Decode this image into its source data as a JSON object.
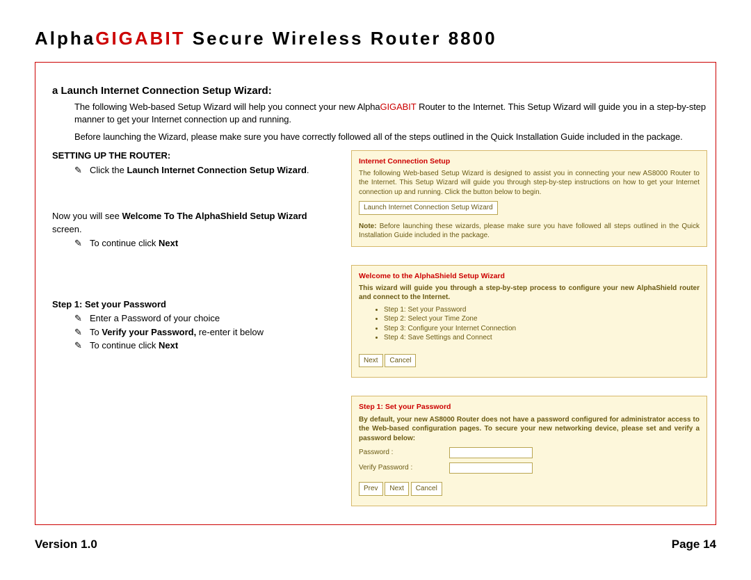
{
  "title": {
    "part1": "Alpha",
    "brand": "GIGABIT",
    "part2": " Secure Wireless Router 8800"
  },
  "sectionA": {
    "heading": "a Launch Internet Connection Setup Wizard:",
    "p1a": "The following Web-based Setup Wizard will help you connect your new Alpha",
    "p1brand": "GIGABIT",
    "p1b": " Router to the Internet. This Setup Wizard will guide you in a step-by-step manner to get your Internet connection up and running.",
    "p2": "Before launching the Wizard, please make sure you have correctly followed all of the steps outlined in the Quick Installation Guide included in the package."
  },
  "settingUp": {
    "heading": "SETTING UP THE ROUTER:",
    "bullet_prefix": "Click the ",
    "bullet_bold": "Launch Internet Connection Setup Wizard",
    "bullet_suffix": "."
  },
  "welcome": {
    "lead_prefix": "Now you will see ",
    "lead_bold": "Welcome To The AlphaShield Setup Wizard",
    "lead_suffix": " screen.",
    "bullet_prefix": "To continue click ",
    "bullet_bold": "Next"
  },
  "step1": {
    "heading": "Step 1:  Set your Password",
    "b1": "Enter a Password of your choice",
    "b2_prefix": "To ",
    "b2_bold": "Verify your Password,",
    "b2_suffix": " re-enter it below",
    "b3_prefix": "To continue click ",
    "b3_bold": "Next"
  },
  "panel1": {
    "title": "Internet Connection Setup",
    "desc": "The following Web-based Setup Wizard is designed to assist you in connecting your new AS8000 Router to the Internet. This Setup Wizard will guide you through step-by-step instructions on how to get your Internet connection up and running. Click the button below to begin.",
    "button": "Launch Internet Connection Setup Wizard",
    "note_label": "Note:",
    "note": " Before launching these wizards, please make sure you have followed all steps outlined in the Quick Installation Guide included in the package."
  },
  "panel2": {
    "title": "Welcome to the AlphaShield Setup Wizard",
    "desc": "This wizard will guide you through a step-by-step process to configure your new AlphaShield router and connect to the Internet.",
    "steps": [
      "Step 1: Set your Password",
      "Step 2: Select your Time Zone",
      "Step 3: Configure your Internet Connection",
      "Step 4: Save Settings and Connect"
    ],
    "btn_next": "Next",
    "btn_cancel": "Cancel"
  },
  "panel3": {
    "title": "Step 1: Set your Password",
    "desc": "By default, your new AS8000 Router does not have a password configured for administrator access to the Web-based configuration pages. To secure your new networking device, please set and verify a password below:",
    "lbl_password": "Password :",
    "lbl_verify": "Verify Password :",
    "btn_prev": "Prev",
    "btn_next": "Next",
    "btn_cancel": "Cancel"
  },
  "footer": {
    "version": "Version 1.0",
    "page": "Page 14"
  },
  "pencil": "✎"
}
